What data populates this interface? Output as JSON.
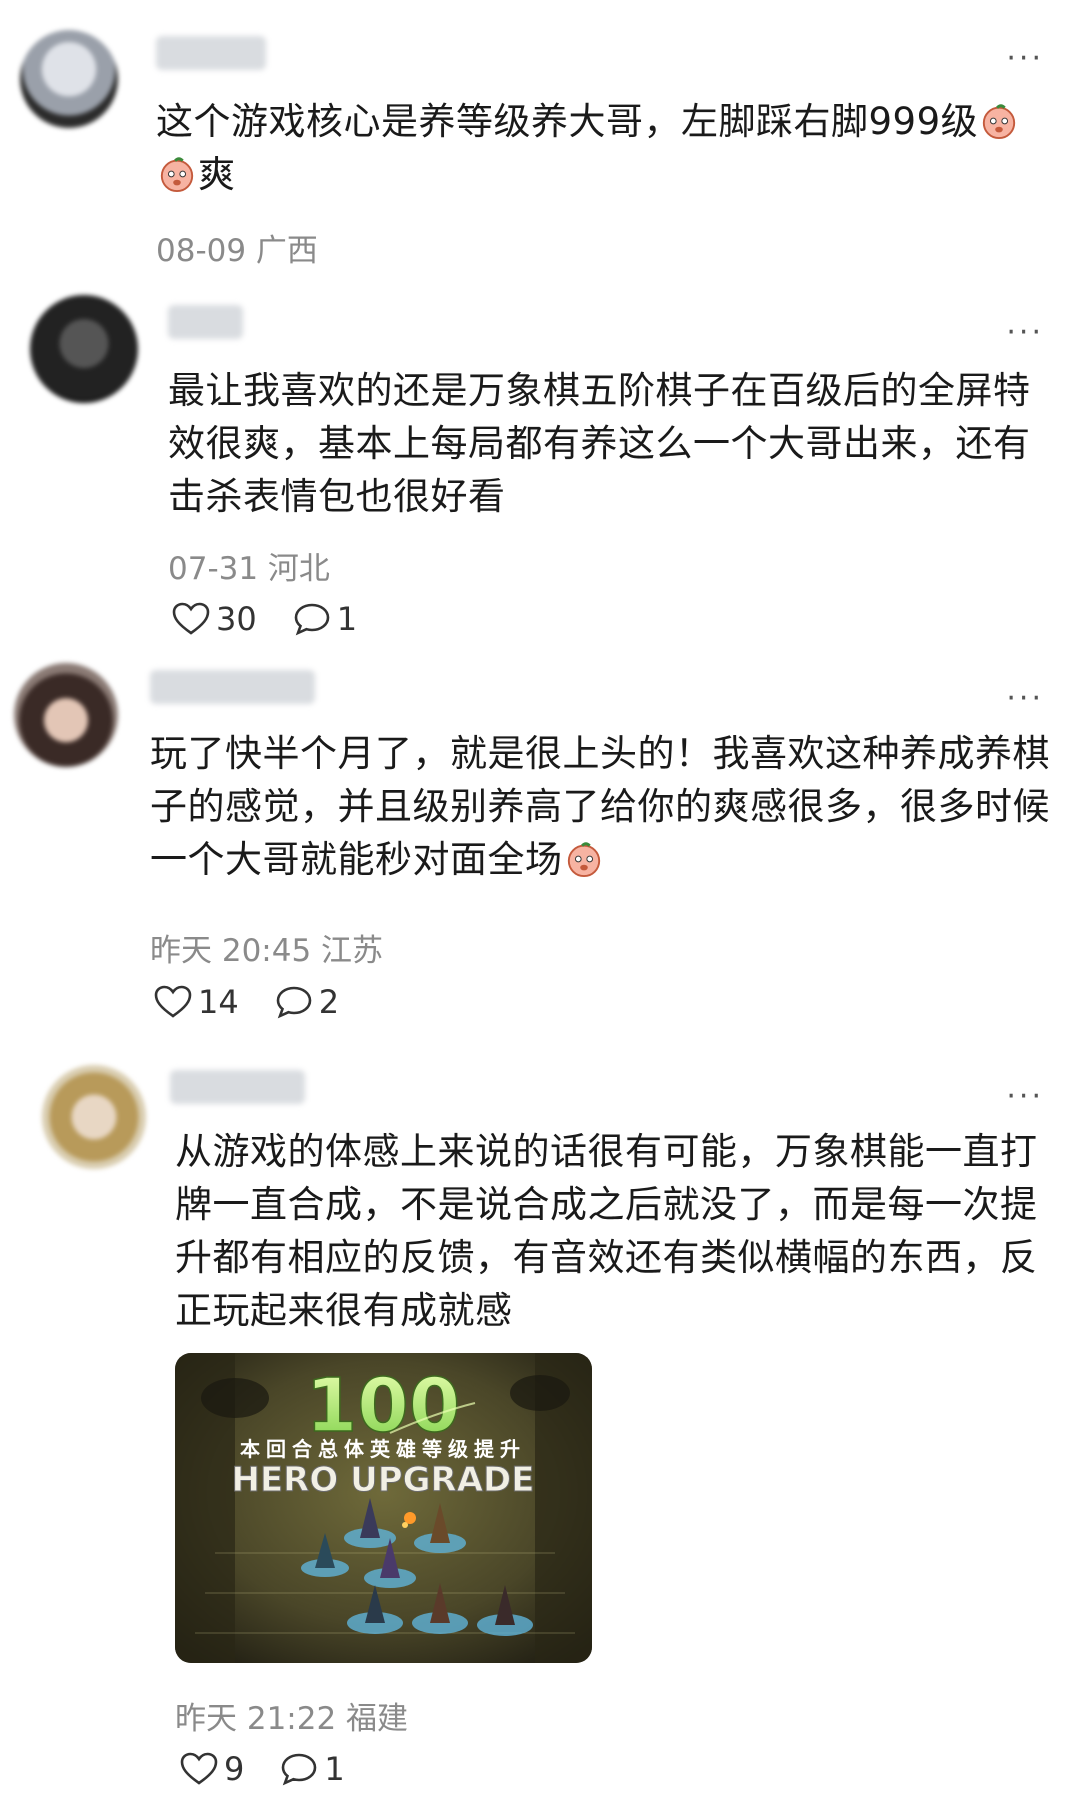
{
  "comments": [
    {
      "body": "这个游戏核心是养等级养大哥，左脚踩右脚999级",
      "body_tail": "爽",
      "meta": "08-09 广西",
      "avatar_color": "#c8ccd4"
    },
    {
      "body": "最让我喜欢的还是万象棋五阶棋子在百级后的全屏特效很爽，基本上每局都有养这么一个大哥出来，还有击杀表情包也很好看",
      "meta": "07-31 河北",
      "likes": "30",
      "replies": "1",
      "avatar_color": "#3a3a3a"
    },
    {
      "body": "玩了快半个月了，就是很上头的！我喜欢这种养成养棋子的感觉，并且级别养高了给你的爽感很多，很多时候一个大哥就能秒对面全场",
      "meta": "昨天 20:45 江苏",
      "likes": "14",
      "replies": "2",
      "avatar_color": "#6b5a52"
    },
    {
      "body": "从游戏的体感上来说的话很有可能，万象棋能一直打牌一直合成，不是说合成之后就没了，而是每一次提升都有相应的反馈，有音效还有类似横幅的东西，反正玩起来很有成就感",
      "meta": "昨天 21:22 福建",
      "likes": "9",
      "replies": "1",
      "avatar_color": "#c9b88a",
      "image": {
        "level": "100",
        "banner_cn": "本回合总体英雄等级提升",
        "banner_en": "HERO UPGRADE"
      }
    }
  ],
  "more_label": "···"
}
